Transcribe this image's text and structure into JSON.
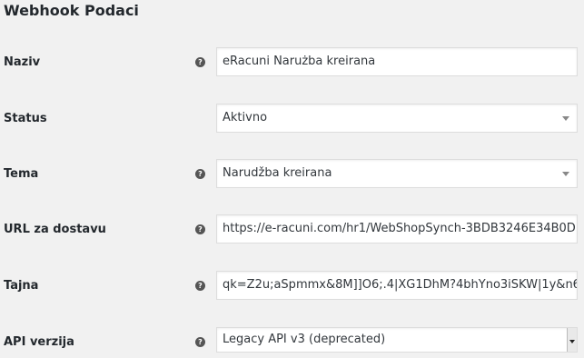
{
  "section": {
    "title": "Webhook Podaci"
  },
  "help_icon_glyph": "?",
  "fields": {
    "name": {
      "label": "Naziv",
      "value": "eRacuni Narużba kreirana"
    },
    "status": {
      "label": "Status",
      "selected": "Aktivno"
    },
    "topic": {
      "label": "Tema",
      "selected": "Narudžba kreirana"
    },
    "delivery_url": {
      "label": "URL za dostavu",
      "value": "https://e-racuni.com/hr1/WebShopSynch-3BDB3246E34B0D"
    },
    "secret": {
      "label": "Tajna",
      "value": "qk=Z2u;aSpmmx&8M]]O6;.4|XG1DhM?4bhYno3iSKW|1y&n6"
    },
    "api_version": {
      "label": "API verzija",
      "selected": "Legacy API v3 (deprecated)"
    }
  },
  "colors": {
    "background": "#f1f1f1",
    "text": "#23282d",
    "field_border": "#dddddd",
    "help_icon": "#555555"
  },
  "icons": [
    "help-icon",
    "chevron-down-icon"
  ]
}
